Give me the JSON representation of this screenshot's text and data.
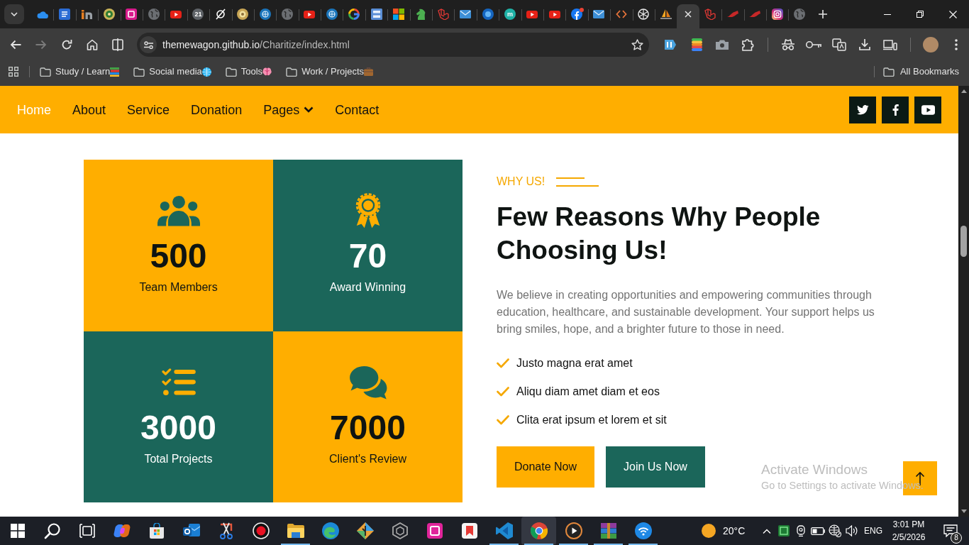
{
  "browser": {
    "tabs": [
      {
        "kind": "cloud",
        "selected": false,
        "unread": false
      },
      {
        "kind": "document",
        "selected": false,
        "unread": false
      },
      {
        "kind": "bar-arch",
        "selected": false,
        "unread": false
      },
      {
        "kind": "emblem",
        "selected": false,
        "unread": false
      },
      {
        "kind": "pink-square",
        "selected": false,
        "unread": false
      },
      {
        "kind": "globe",
        "selected": false,
        "unread": false
      },
      {
        "kind": "play",
        "selected": false,
        "unread": false
      },
      {
        "kind": "letter",
        "text": "21",
        "color": "#5f6368",
        "selected": false,
        "unread": false
      },
      {
        "kind": "slashed-circle",
        "selected": false,
        "unread": false
      },
      {
        "kind": "gold-emblem",
        "selected": false,
        "unread": false
      },
      {
        "kind": "globe-emblem",
        "selected": false,
        "unread": false
      },
      {
        "kind": "globe",
        "selected": false,
        "unread": false
      },
      {
        "kind": "play",
        "selected": false,
        "unread": false
      },
      {
        "kind": "globe-emblem",
        "selected": false,
        "unread": false
      },
      {
        "kind": "ring",
        "selected": false,
        "unread": false
      },
      {
        "kind": "tile",
        "selected": false,
        "unread": false
      },
      {
        "kind": "four-squares",
        "selected": false,
        "unread": false
      },
      {
        "kind": "horse",
        "selected": false,
        "unread": false
      },
      {
        "kind": "cube",
        "selected": false,
        "unread": false
      },
      {
        "kind": "envelope",
        "selected": false,
        "unread": false
      },
      {
        "kind": "disc",
        "selected": false,
        "unread": false
      },
      {
        "kind": "letter",
        "text": "m",
        "color": "#1fb2a6",
        "selected": false,
        "unread": false
      },
      {
        "kind": "play",
        "selected": false,
        "unread": false
      },
      {
        "kind": "play",
        "selected": false,
        "unread": false
      },
      {
        "kind": "facebook",
        "selected": false,
        "unread": true
      },
      {
        "kind": "envelope",
        "selected": false,
        "unread": false
      },
      {
        "kind": "code",
        "selected": false,
        "unread": false
      },
      {
        "kind": "knot",
        "selected": false,
        "unread": false
      },
      {
        "kind": "sailboat",
        "selected": false,
        "unread": false
      },
      {
        "kind": "none",
        "selected": true,
        "unread": false
      },
      {
        "kind": "cube",
        "selected": false,
        "unread": false
      },
      {
        "kind": "swoosh",
        "selected": false,
        "unread": false
      },
      {
        "kind": "swoosh",
        "selected": false,
        "unread": false
      },
      {
        "kind": "camera-square",
        "selected": false,
        "unread": false
      },
      {
        "kind": "globe",
        "selected": false,
        "unread": false
      }
    ],
    "nav_buttons": [
      {
        "kind": "back",
        "disabled": false
      },
      {
        "kind": "forward",
        "disabled": true
      },
      {
        "kind": "reload",
        "disabled": false
      },
      {
        "kind": "home",
        "disabled": false
      },
      {
        "kind": "split",
        "disabled": false
      }
    ],
    "address": {
      "host": "themewagon.github.io",
      "path": "/Charitize/index.html"
    },
    "bookmarks": [
      {
        "label": "Study / Learn",
        "kind": "books"
      },
      {
        "label": "Social media",
        "kind": "globe"
      },
      {
        "label": "Tools",
        "kind": "brain"
      },
      {
        "label": "Work / Projects",
        "kind": "briefcase"
      }
    ],
    "all_bookmarks": "All Bookmarks"
  },
  "page": {
    "nav": {
      "links": [
        {
          "label": "Home",
          "selected": true,
          "dropdown": false
        },
        {
          "label": "About",
          "selected": false,
          "dropdown": false
        },
        {
          "label": "Service",
          "selected": false,
          "dropdown": false
        },
        {
          "label": "Donation",
          "selected": false,
          "dropdown": false
        },
        {
          "label": "Pages",
          "selected": false,
          "dropdown": true
        },
        {
          "label": "Contact",
          "selected": false,
          "dropdown": false
        }
      ],
      "social": [
        {
          "kind": "twitter"
        },
        {
          "kind": "facebook"
        },
        {
          "kind": "youtube"
        }
      ]
    },
    "stats": [
      {
        "kind": "team",
        "value": "500",
        "label": "Team Members",
        "color": "#ffae00"
      },
      {
        "kind": "award",
        "value": "70",
        "label": "Award Winning",
        "color": "#1b665a"
      },
      {
        "kind": "projects",
        "value": "3000",
        "label": "Total Projects",
        "color": "#1b665a"
      },
      {
        "kind": "reviews",
        "value": "7000",
        "label": "Client's Review",
        "color": "#ffae00"
      }
    ],
    "eyebrow": "WHY US!",
    "heading": "Few Reasons Why People Choosing Us!",
    "body": "We believe in creating opportunities and empowering communities through education, healthcare, and sustainable development. Your support helps us bring smiles, hope, and a brighter future to those in need.",
    "features": [
      "Justo magna erat amet",
      "Aliqu diam amet diam et eos",
      "Clita erat ipsum et lorem et sit"
    ],
    "buttons": [
      {
        "label": "Donate Now",
        "kind": "primary"
      },
      {
        "label": "Join Us Now",
        "kind": "secondary"
      }
    ]
  },
  "os_overlay": {
    "title": "Activate Windows",
    "subtitle": "Go to Settings to activate Windows."
  },
  "taskbar": {
    "apps": [
      {
        "kind": "start",
        "running": false,
        "selected": false
      },
      {
        "kind": "search",
        "running": false,
        "selected": false
      },
      {
        "kind": "task-view",
        "running": false,
        "selected": false
      },
      {
        "kind": "swirl",
        "running": false,
        "selected": false
      },
      {
        "kind": "store",
        "running": false,
        "selected": false
      },
      {
        "kind": "mail",
        "running": false,
        "selected": false
      },
      {
        "kind": "scissors",
        "running": false,
        "selected": false
      },
      {
        "kind": "record",
        "running": false,
        "selected": false
      },
      {
        "kind": "folder",
        "running": true,
        "selected": false
      },
      {
        "kind": "wave",
        "running": false,
        "selected": false
      },
      {
        "kind": "diamond",
        "running": false,
        "selected": false
      },
      {
        "kind": "hexagon",
        "running": false,
        "selected": false
      },
      {
        "kind": "pink-square",
        "running": false,
        "selected": false
      },
      {
        "kind": "tile",
        "running": false,
        "selected": false
      },
      {
        "kind": "ribbon",
        "running": true,
        "selected": false
      },
      {
        "kind": "segmented-circle",
        "running": true,
        "selected": true
      },
      {
        "kind": "play-circle",
        "running": true,
        "selected": false
      },
      {
        "kind": "books",
        "running": true,
        "selected": false
      },
      {
        "kind": "wifi",
        "running": true,
        "selected": false
      }
    ],
    "weather": {
      "temperature": "20°C"
    },
    "language": "ENG",
    "time": "3:01 PM",
    "date": "2/5/2026",
    "notifications": "8"
  }
}
